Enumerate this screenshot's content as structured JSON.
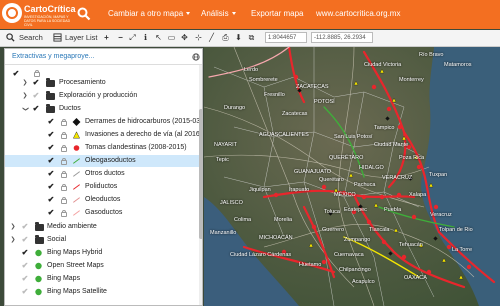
{
  "nav": {
    "brand": "CartoCrítica",
    "brand_sub": "INVESTIGACIÓN, MAPAS Y DATOS PARA LA SOCIEDAD CIVIL",
    "items": [
      "Cambiar a otro mapa",
      "Análisis",
      "Exportar mapa",
      "www.cartocritica.org.mx"
    ]
  },
  "toolbar": {
    "search_label": "Search",
    "layer_list_label": "Layer List",
    "scale_value": "1:8044657",
    "coordinates": "-112.8885, 26.2934"
  },
  "panel": {
    "title": "Extractivas y megaproye...",
    "rows": [
      {
        "label": "Procesamiento"
      },
      {
        "label": "Exploración y producción"
      },
      {
        "label": "Ductos"
      },
      {
        "label": "Derrames de hidrocarburos (2015-03 a"
      },
      {
        "label": "Invasiones a derecho de vía (al 2016)"
      },
      {
        "label": "Tomas clandestinas (2008-2015)"
      },
      {
        "label": "Oleogasoductos"
      },
      {
        "label": "Otros ductos"
      },
      {
        "label": "Poliductos"
      },
      {
        "label": "Oleoductos"
      },
      {
        "label": "Gasoductos"
      },
      {
        "label": "Medio ambiente"
      },
      {
        "label": "Social"
      },
      {
        "label": "Bing Maps Hybrid"
      },
      {
        "label": "Open Street Maps"
      },
      {
        "label": "Bing Maps"
      },
      {
        "label": "Bing Maps Satellite"
      }
    ]
  },
  "map": {
    "labels": [
      "ZACATECAS",
      "POTOSÍ",
      "Zacatecas",
      "Durango",
      "NAYARIT",
      "AGUASCALIENTES",
      "Tepic",
      "JALISCO",
      "GUANAJUATO",
      "QUERÉTARO",
      "HIDALGO",
      "Manzanillo",
      "MICHOACÁN",
      "MÉXICO",
      "Acapulco",
      "Ciudad Lázaro Cárdenas",
      "Guerrero",
      "Xalapa",
      "Puebla",
      "Veracruz",
      "VERACRUZ",
      "Poza Rica",
      "Tampico",
      "Ciudad Victoria",
      "San Luis Potosí",
      "Morelia",
      "Toluca",
      "Cuernavaca",
      "OAXACA",
      "Tlaxcala",
      "Tuxpan",
      "Tehuacán",
      "La Torre",
      "Río Bravo",
      "Monterrey",
      "Matamoros",
      "Tolpan de Rio",
      "Ciudad Mante",
      "Lerdo",
      "Colima",
      "Zumpango",
      "Pachuca",
      "Jiquilpan",
      "Querétaro",
      "Fresnillo",
      "Sombrerete",
      "Ecatepec",
      "Irapuato",
      "Huetamo",
      "Chilpancingo"
    ]
  },
  "colors": {
    "nav_bg": "#f36f21",
    "selected_row": "#cfe8fb",
    "pipeline_red": "#e8262c",
    "pipeline_yellow": "#f4e600",
    "pipeline_green": "#3fae3a"
  }
}
